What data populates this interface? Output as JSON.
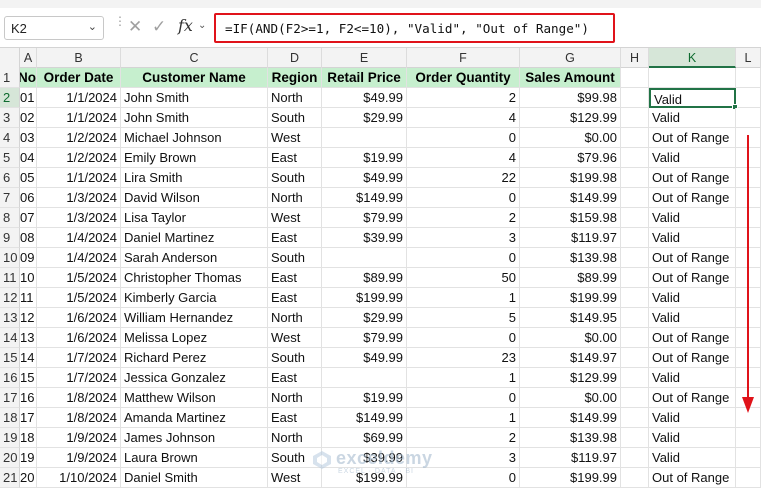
{
  "formula_bar": {
    "name_box": "K2",
    "fx_label": "fx",
    "formula": "=IF(AND(F2>=1, F2<=10), \"Valid\", \"Out of Range\")"
  },
  "columns": [
    {
      "letter": "A",
      "left": 0
    },
    {
      "letter": "B"
    },
    {
      "letter": "C"
    },
    {
      "letter": "D"
    },
    {
      "letter": "E"
    },
    {
      "letter": "F"
    },
    {
      "letter": "G"
    },
    {
      "letter": "H"
    },
    {
      "letter": "K"
    },
    {
      "letter": "L"
    }
  ],
  "headers": {
    "A": "No",
    "B": "Order Date",
    "C": "Customer Name",
    "D": "Region",
    "E": "Retail Price",
    "F": "Order Quantity",
    "G": "Sales Amount"
  },
  "rows": [
    {
      "n": "2",
      "a": "01",
      "b": "1/1/2024",
      "c": "John Smith",
      "d": "North",
      "e": "$49.99",
      "f": "2",
      "g": "$99.98",
      "k": "Valid"
    },
    {
      "n": "3",
      "a": "02",
      "b": "1/1/2024",
      "c": "John Smith",
      "d": "South",
      "e": "$29.99",
      "f": "4",
      "g": "$129.99",
      "k": "Valid"
    },
    {
      "n": "4",
      "a": "03",
      "b": "1/2/2024",
      "c": "Michael Johnson",
      "d": "West",
      "e": "",
      "f": "0",
      "g": "$0.00",
      "k": "Out of Range"
    },
    {
      "n": "5",
      "a": "04",
      "b": "1/2/2024",
      "c": "Emily Brown",
      "d": "East",
      "e": "$19.99",
      "f": "4",
      "g": "$79.96",
      "k": "Valid"
    },
    {
      "n": "6",
      "a": "05",
      "b": "1/1/2024",
      "c": "Lira Smith",
      "d": "South",
      "e": "$49.99",
      "f": "22",
      "g": "$199.98",
      "k": "Out of Range"
    },
    {
      "n": "7",
      "a": "06",
      "b": "1/3/2024",
      "c": "David Wilson",
      "d": "North",
      "e": "$149.99",
      "f": "0",
      "g": "$149.99",
      "k": "Out of Range"
    },
    {
      "n": "8",
      "a": "07",
      "b": "1/3/2024",
      "c": "Lisa Taylor",
      "d": "West",
      "e": "$79.99",
      "f": "2",
      "g": "$159.98",
      "k": "Valid"
    },
    {
      "n": "9",
      "a": "08",
      "b": "1/4/2024",
      "c": "Daniel Martinez",
      "d": "East",
      "e": "$39.99",
      "f": "3",
      "g": "$119.97",
      "k": "Valid"
    },
    {
      "n": "10",
      "a": "09",
      "b": "1/4/2024",
      "c": "Sarah Anderson",
      "d": "South",
      "e": "",
      "f": "0",
      "g": "$139.98",
      "k": "Out of Range"
    },
    {
      "n": "11",
      "a": "10",
      "b": "1/5/2024",
      "c": "Christopher Thomas",
      "d": "East",
      "e": "$89.99",
      "f": "50",
      "g": "$89.99",
      "k": "Out of Range"
    },
    {
      "n": "12",
      "a": "11",
      "b": "1/5/2024",
      "c": "Kimberly Garcia",
      "d": "East",
      "e": "$199.99",
      "f": "1",
      "g": "$199.99",
      "k": "Valid"
    },
    {
      "n": "13",
      "a": "12",
      "b": "1/6/2024",
      "c": "William Hernandez",
      "d": "North",
      "e": "$29.99",
      "f": "5",
      "g": "$149.95",
      "k": "Valid"
    },
    {
      "n": "14",
      "a": "13",
      "b": "1/6/2024",
      "c": "Melissa Lopez",
      "d": "West",
      "e": "$79.99",
      "f": "0",
      "g": "$0.00",
      "k": "Out of Range"
    },
    {
      "n": "15",
      "a": "14",
      "b": "1/7/2024",
      "c": "Richard Perez",
      "d": "South",
      "e": "$49.99",
      "f": "23",
      "g": "$149.97",
      "k": "Out of Range"
    },
    {
      "n": "16",
      "a": "15",
      "b": "1/7/2024",
      "c": "Jessica Gonzalez",
      "d": "East",
      "e": "",
      "f": "1",
      "g": "$129.99",
      "k": "Valid"
    },
    {
      "n": "17",
      "a": "16",
      "b": "1/8/2024",
      "c": "Matthew Wilson",
      "d": "North",
      "e": "$19.99",
      "f": "0",
      "g": "$0.00",
      "k": "Out of Range"
    },
    {
      "n": "18",
      "a": "17",
      "b": "1/8/2024",
      "c": "Amanda Martinez",
      "d": "East",
      "e": "$149.99",
      "f": "1",
      "g": "$149.99",
      "k": "Valid"
    },
    {
      "n": "19",
      "a": "18",
      "b": "1/9/2024",
      "c": "James Johnson",
      "d": "North",
      "e": "$69.99",
      "f": "2",
      "g": "$139.98",
      "k": "Valid"
    },
    {
      "n": "20",
      "a": "19",
      "b": "1/9/2024",
      "c": "Laura Brown",
      "d": "South",
      "e": "$39.99",
      "f": "3",
      "g": "$119.97",
      "k": "Valid"
    },
    {
      "n": "21",
      "a": "20",
      "b": "1/10/2024",
      "c": "Daniel Smith",
      "d": "West",
      "e": "$199.99",
      "f": "0",
      "g": "$199.99",
      "k": "Out of Range"
    }
  ],
  "header_row_num": "1",
  "watermark": {
    "brand": "exceldemy",
    "tagline": "EXCEL · DATA · BI"
  },
  "colors": {
    "accent_green": "#217346",
    "header_fill": "#c6efce",
    "highlight_red": "#e0131a"
  }
}
